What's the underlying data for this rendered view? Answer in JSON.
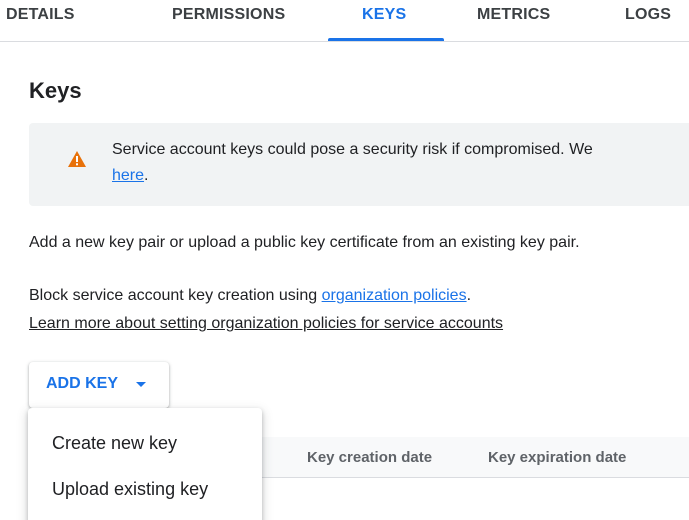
{
  "tabs": [
    {
      "label": "DETAILS"
    },
    {
      "label": "PERMISSIONS"
    },
    {
      "label": "KEYS"
    },
    {
      "label": "METRICS"
    },
    {
      "label": "LOGS"
    }
  ],
  "active_tab": "KEYS",
  "section": {
    "title": "Keys"
  },
  "banner": {
    "icon": "warning-triangle-icon",
    "icon_color": "#e8710a",
    "text": "Service account keys could pose a security risk if compromised. We",
    "link_text": "here",
    "trailing": "."
  },
  "description": "Add a new key pair or upload a public key certificate from an existing key pair.",
  "policy": {
    "prefix": "Block service account key creation using ",
    "link": "organization policies",
    "suffix": ".",
    "learn_more": "Learn more about setting organization policies for service accounts"
  },
  "add_key_button": {
    "label": "ADD KEY",
    "icon": "caret-down-icon"
  },
  "menu": {
    "items": [
      "Create new key",
      "Upload existing key"
    ]
  },
  "table": {
    "columns": [
      "Key creation date",
      "Key expiration date"
    ]
  },
  "colors": {
    "accent": "#1a73e8",
    "banner_bg": "#f1f3f4",
    "warning": "#e8710a"
  }
}
